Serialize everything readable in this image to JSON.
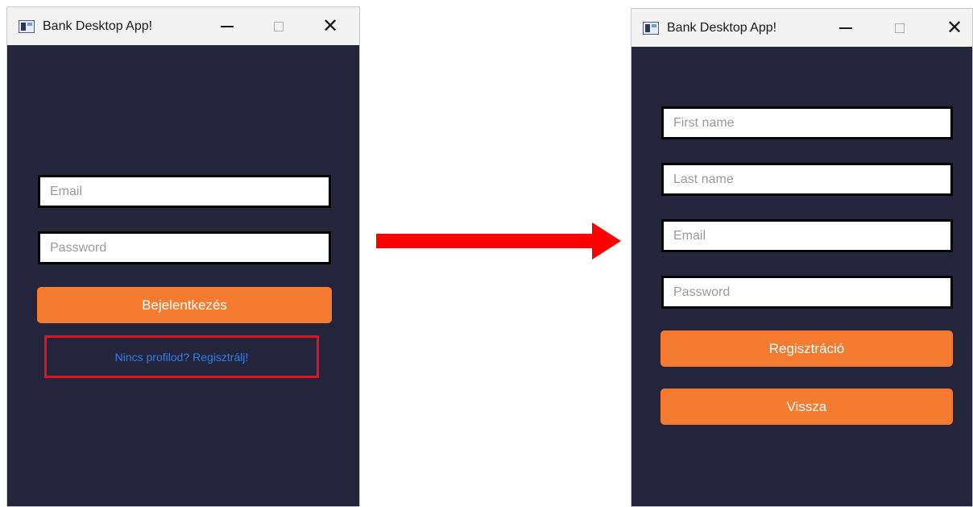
{
  "login_window": {
    "title": "Bank Desktop App!",
    "email_placeholder": "Email",
    "password_placeholder": "Password",
    "login_button": "Bejelentkezés",
    "register_link": "Nincs profilod? Regisztrálj!"
  },
  "register_window": {
    "title": "Bank Desktop App!",
    "first_name_placeholder": "First name",
    "last_name_placeholder": "Last name",
    "email_placeholder": "Email",
    "password_placeholder": "Password",
    "register_button": "Regisztráció",
    "back_button": "Vissza"
  },
  "icons": {
    "window_minimize": "minimize-icon",
    "window_maximize": "maximize-icon",
    "window_close": "close-icon",
    "transition_arrow": "arrow-right-icon"
  },
  "colors": {
    "window_background": "#24253c",
    "button": "#f47b2f",
    "link": "#2f7fe6",
    "highlight": "#e8101a",
    "arrow": "#ff0000"
  }
}
